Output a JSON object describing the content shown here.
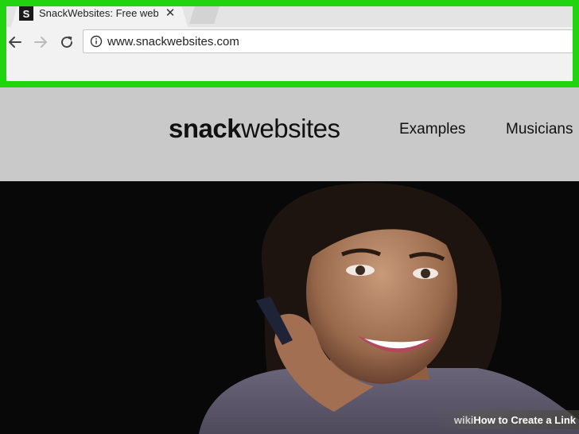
{
  "browser": {
    "tab": {
      "favicon_letter": "S",
      "title": "SnackWebsites: Free web",
      "close_glyph": "✕"
    },
    "address_bar": {
      "url": "www.snackwebsites.com"
    },
    "icons": [
      "back-arrow-icon",
      "forward-arrow-icon",
      "reload-icon",
      "info-icon",
      "close-icon"
    ],
    "highlight_color": "#22d30f"
  },
  "site": {
    "logo_bold": "snack",
    "logo_regular": "websites",
    "nav": [
      "Examples",
      "Musicians"
    ],
    "header_bg": "#c9c9c9"
  },
  "watermark": {
    "prefix": "wiki",
    "text": "How to Create a Link"
  }
}
